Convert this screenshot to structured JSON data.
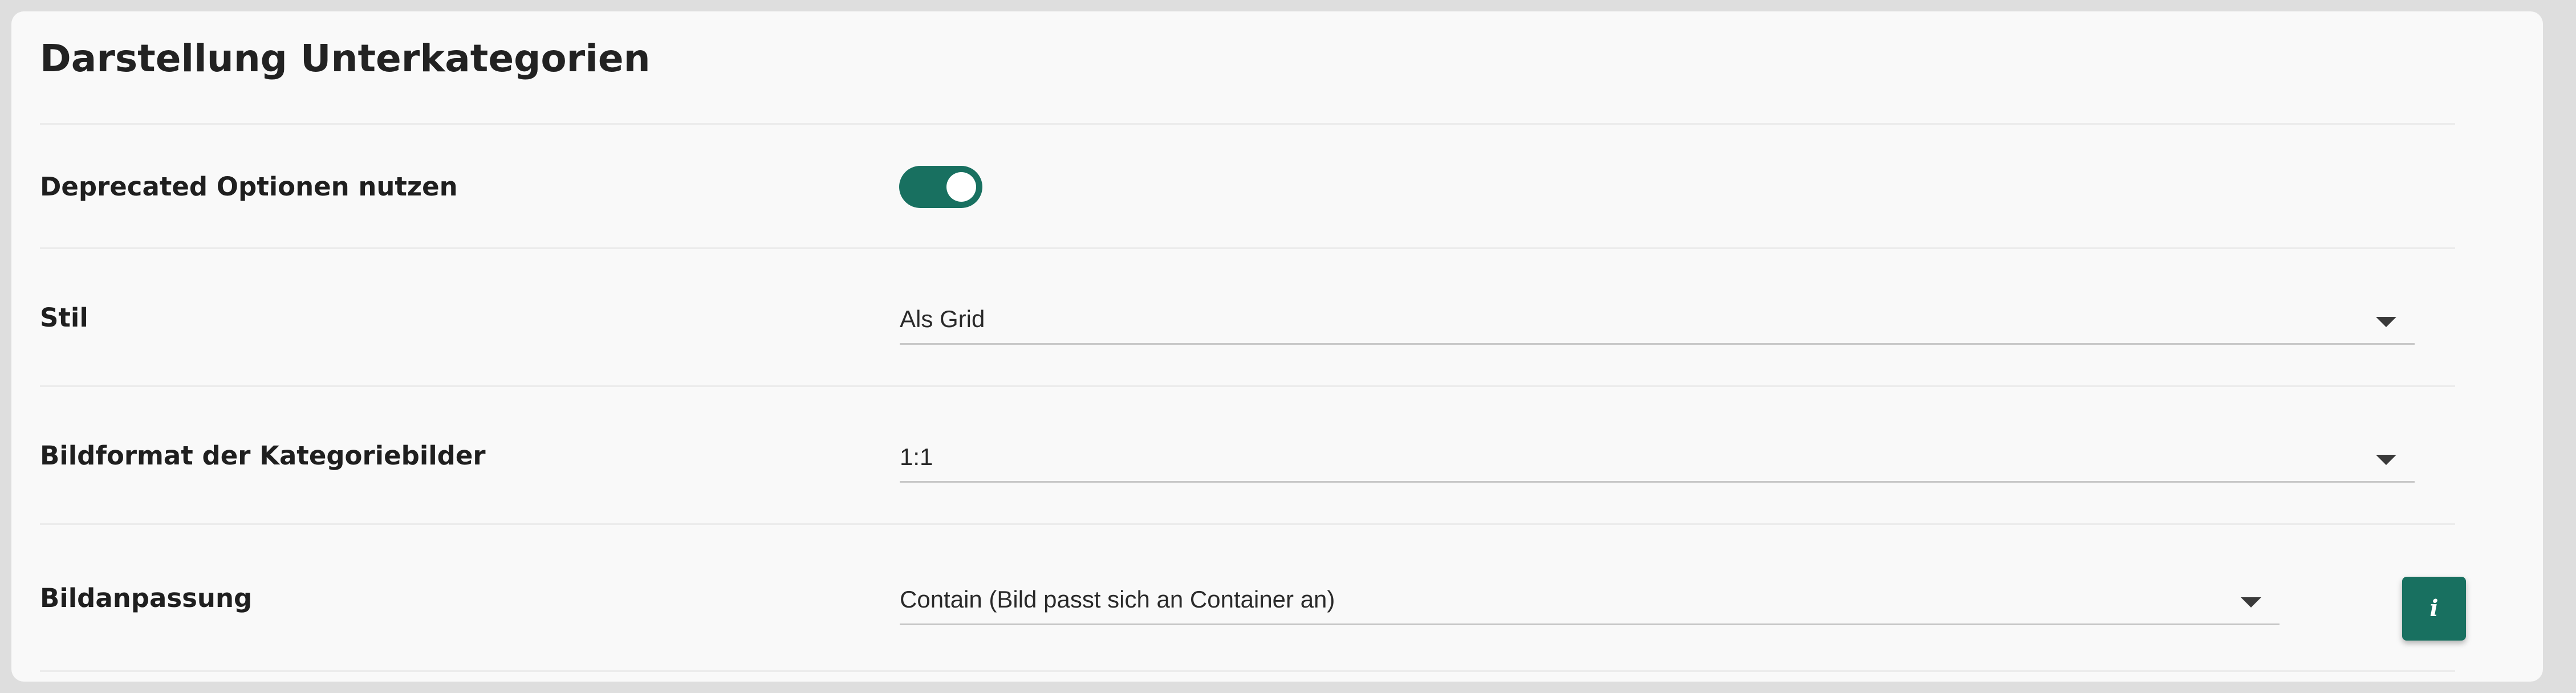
{
  "section": {
    "title": "Darstellung Unterkategorien"
  },
  "settings": [
    {
      "label": "Deprecated Optionen nutzen",
      "control": "toggle",
      "state": "on"
    },
    {
      "label": "Stil",
      "control": "select",
      "value": "Als Grid"
    },
    {
      "label": "Bildformat der Kategoriebilder",
      "control": "select",
      "value": "1:1"
    },
    {
      "label": "Bildanpassung",
      "control": "select",
      "value": "Contain (Bild passt sich an Container an)",
      "info_button_icon": "info-icon",
      "info_button_glyph": "i"
    }
  ],
  "colors": {
    "accent": "#187060",
    "background": "#f9f9f9",
    "frame": "#dedede"
  },
  "icons": {
    "dropdown": "caret-down-icon",
    "info": "info-icon"
  }
}
